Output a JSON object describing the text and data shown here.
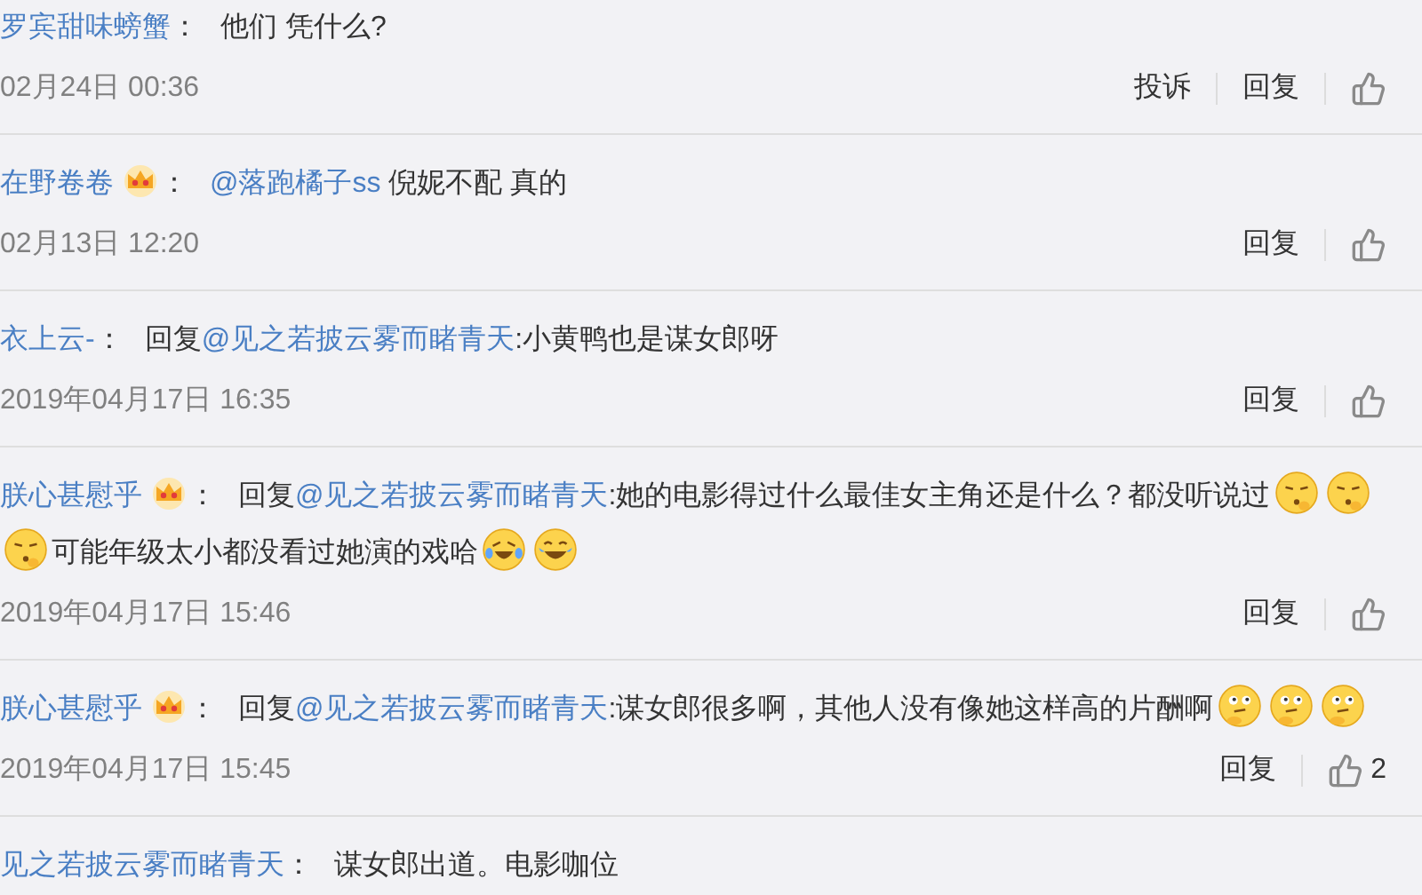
{
  "comments": [
    {
      "user": "罗宾甜味螃蟹",
      "vip": false,
      "separator": "：",
      "content": [
        {
          "kind": "text",
          "text": "他们 凭什么?"
        }
      ],
      "time": "02月24日 00:36",
      "actions": [
        {
          "kind": "text",
          "label": "投诉"
        },
        {
          "kind": "text",
          "label": "回复"
        },
        {
          "kind": "like"
        }
      ]
    },
    {
      "user": "在野卷卷",
      "vip": true,
      "separator": "：",
      "content": [
        {
          "kind": "link",
          "text": "@落跑橘子ss"
        },
        {
          "kind": "text",
          "text": " 倪妮不配 真的"
        }
      ],
      "time": "02月13日 12:20",
      "actions": [
        {
          "kind": "text",
          "label": "回复"
        },
        {
          "kind": "like"
        }
      ]
    },
    {
      "user": "衣上云-",
      "vip": false,
      "separator": "：",
      "content": [
        {
          "kind": "text",
          "text": "回复"
        },
        {
          "kind": "link",
          "text": "@见之若披云雾而睹青天"
        },
        {
          "kind": "text",
          "text": ":小黄鸭也是谋女郎呀"
        }
      ],
      "time": "2019年04月17日 16:35",
      "actions": [
        {
          "kind": "text",
          "label": "回复"
        },
        {
          "kind": "like"
        }
      ]
    },
    {
      "user": "朕心甚慰乎",
      "vip": true,
      "separator": "：",
      "content": [
        {
          "kind": "text",
          "text": "回复"
        },
        {
          "kind": "link",
          "text": "@见之若披云雾而睹青天"
        },
        {
          "kind": "text",
          "text": ":她的电影得过什么最佳女主角还是什么？都没听说过"
        },
        {
          "kind": "shush"
        },
        {
          "kind": "shush"
        },
        {
          "kind": "shush"
        },
        {
          "kind": "text",
          "text": "可能年级太小都没看过她演的戏哈"
        },
        {
          "kind": "cry-laugh"
        },
        {
          "kind": "laugh"
        }
      ],
      "time": "2019年04月17日 15:46",
      "actions": [
        {
          "kind": "text",
          "label": "回复"
        },
        {
          "kind": "like"
        }
      ]
    },
    {
      "user": "朕心甚慰乎",
      "vip": true,
      "separator": "：",
      "content": [
        {
          "kind": "text",
          "text": "回复"
        },
        {
          "kind": "link",
          "text": "@见之若披云雾而睹青天"
        },
        {
          "kind": "text",
          "text": ":谋女郎很多啊，其他人没有像她这样高的片酬啊"
        },
        {
          "kind": "think"
        },
        {
          "kind": "think"
        },
        {
          "kind": "think"
        }
      ],
      "time": "2019年04月17日 15:45",
      "actions": [
        {
          "kind": "text",
          "label": "回复"
        },
        {
          "kind": "like",
          "count": "2"
        }
      ]
    },
    {
      "user": "见之若披云雾而睹青天",
      "vip": false,
      "separator": "：",
      "content": [
        {
          "kind": "text",
          "text": "谋女郎出道。电影咖位"
        }
      ]
    }
  ]
}
